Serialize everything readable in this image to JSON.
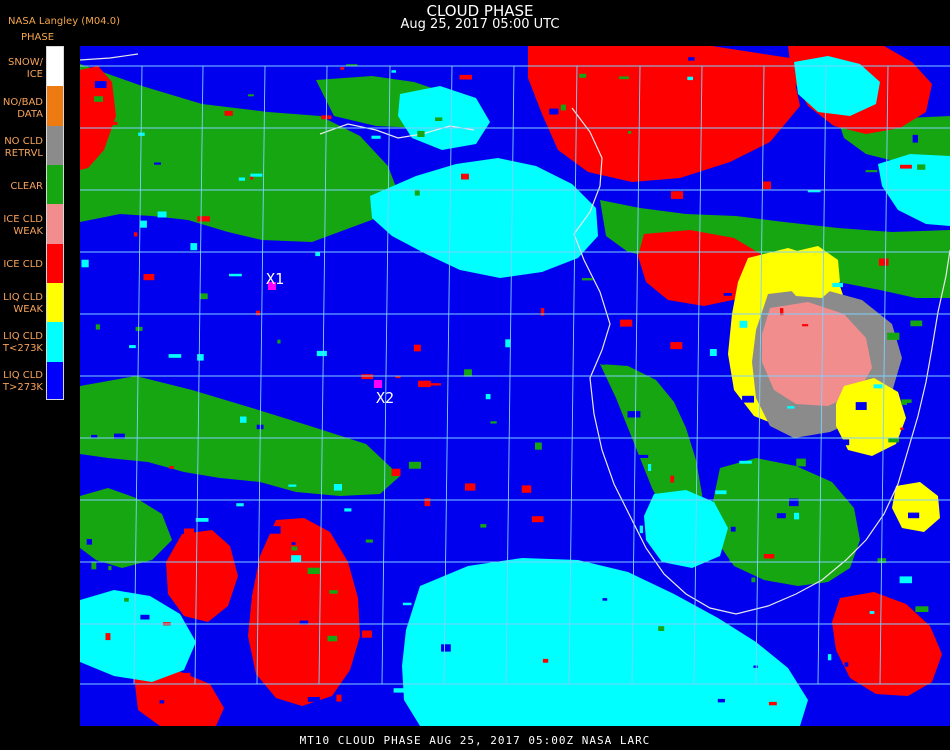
{
  "header": {
    "title": "CLOUD PHASE",
    "subtitle": "Aug 25, 2017 05:00 UTC",
    "source": "NASA Langley (M04.0)"
  },
  "legend": {
    "title": "PHASE",
    "items": [
      {
        "label": "SNOW/\nICE",
        "color": "#ffffff"
      },
      {
        "label": "NO/BAD\nDATA",
        "color": "#ee7b12"
      },
      {
        "label": "NO CLD\nRETRVL",
        "color": "#8b8b8b"
      },
      {
        "label": "CLEAR",
        "color": "#16a612"
      },
      {
        "label": "ICE CLD\nWEAK",
        "color": "#f28d8d"
      },
      {
        "label": "ICE CLD",
        "color": "#ff0000"
      },
      {
        "label": "LIQ CLD\nWEAK",
        "color": "#ffff00"
      },
      {
        "label": "LIQ CLD\nT<273K",
        "color": "#00ffff"
      },
      {
        "label": "LIQ CLD\nT>273K",
        "color": "#0000ff"
      }
    ]
  },
  "map": {
    "points": [
      {
        "label": "X1",
        "color": "#ff00ff"
      },
      {
        "label": "X2",
        "color": "#ff00ff"
      }
    ],
    "colors": {
      "ocean": "#0000ef",
      "clear": "#16a612",
      "ice": "#ff0000",
      "liq_cold": "#00ffff",
      "liq_weak": "#ffff00",
      "ice_weak": "#f28d8d",
      "no_retrieval": "#8b8b8b",
      "grid": "#7fd0ff"
    }
  },
  "footer": {
    "text": "MT10  CLOUD PHASE    AUG 25, 2017 05:00Z   NASA LARC"
  }
}
